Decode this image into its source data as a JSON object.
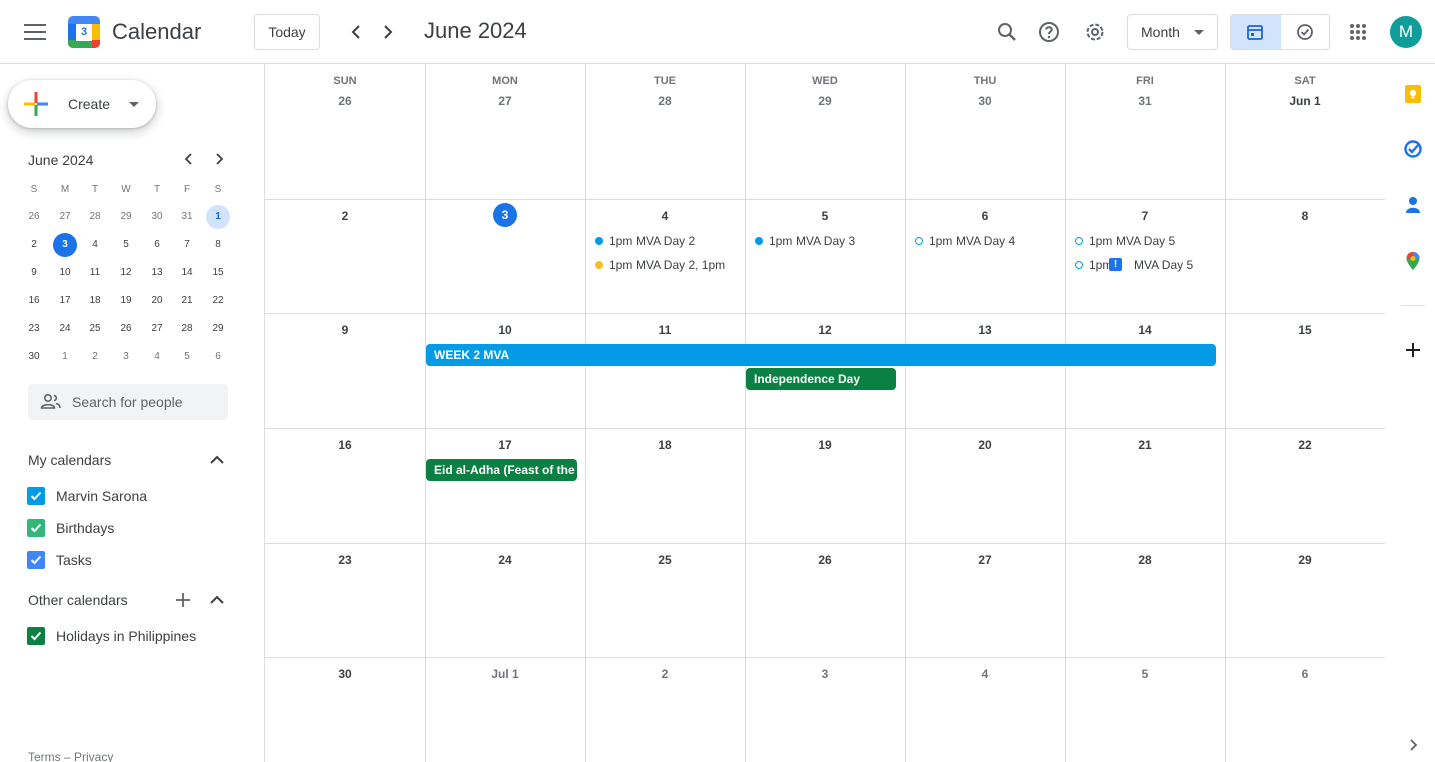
{
  "app": {
    "title": "Calendar",
    "logo_day": "3"
  },
  "header": {
    "today_label": "Today",
    "period": "June 2024",
    "view": "Month",
    "avatar_initial": "M",
    "icons": [
      "menu-icon",
      "chevron-left-icon",
      "chevron-right-icon",
      "search-icon",
      "help-icon",
      "settings-icon",
      "calendar-view-icon",
      "tasks-view-icon",
      "apps-icon"
    ]
  },
  "sidebar": {
    "create_label": "Create",
    "mini_month": {
      "title": "June 2024",
      "weekday_heads": [
        "S",
        "M",
        "T",
        "W",
        "T",
        "F",
        "S"
      ],
      "weeks": [
        [
          "26",
          "27",
          "28",
          "29",
          "30",
          "31",
          "1"
        ],
        [
          "2",
          "3",
          "4",
          "5",
          "6",
          "7",
          "8"
        ],
        [
          "9",
          "10",
          "11",
          "12",
          "13",
          "14",
          "15"
        ],
        [
          "16",
          "17",
          "18",
          "19",
          "20",
          "21",
          "22"
        ],
        [
          "23",
          "24",
          "25",
          "26",
          "27",
          "28",
          "29"
        ],
        [
          "30",
          "1",
          "2",
          "3",
          "4",
          "5",
          "6"
        ]
      ],
      "today": "3",
      "selected": "1"
    },
    "search_people_placeholder": "Search for people",
    "my_calendars": {
      "title": "My calendars",
      "items": [
        {
          "name": "Marvin Sarona",
          "color": "#039be5"
        },
        {
          "name": "Birthdays",
          "color": "#33b679"
        },
        {
          "name": "Tasks",
          "color": "#4285f4"
        }
      ]
    },
    "other_calendars": {
      "title": "Other calendars",
      "items": [
        {
          "name": "Holidays in Philippines",
          "color": "#0b8043"
        }
      ]
    },
    "footer": "Terms – Privacy"
  },
  "month": {
    "weekdays": [
      "SUN",
      "MON",
      "TUE",
      "WED",
      "THU",
      "FRI",
      "SAT"
    ],
    "weeks": [
      [
        "26",
        "27",
        "28",
        "29",
        "30",
        "31",
        "Jun 1"
      ],
      [
        "2",
        "3",
        "4",
        "5",
        "6",
        "7",
        "8"
      ],
      [
        "9",
        "10",
        "11",
        "12",
        "13",
        "14",
        "15"
      ],
      [
        "16",
        "17",
        "18",
        "19",
        "20",
        "21",
        "22"
      ],
      [
        "23",
        "24",
        "25",
        "26",
        "27",
        "28",
        "29"
      ],
      [
        "30",
        "Jul 1",
        "2",
        "3",
        "4",
        "5",
        "6"
      ]
    ],
    "events": [
      {
        "time": "1pm",
        "title": "MVA Day 2",
        "dot": "#039be5"
      },
      {
        "time": "1pm",
        "title": "MVA Day 2, 1pm",
        "dot": "#f6bf26"
      },
      {
        "time": "1pm",
        "title": "MVA Day 3",
        "dot": "#039be5"
      },
      {
        "time": "1pm",
        "title": "MVA Day 4",
        "dot": "#039be5"
      },
      {
        "time": "1pm",
        "title": "MVA Day 5",
        "dot": "#039be5"
      },
      {
        "time": "1pm",
        "title": "MVA Day 5",
        "dot": "#039be5",
        "badge": "!"
      }
    ],
    "all_day": [
      {
        "title": "WEEK 2 MVA",
        "color": "#039be5"
      },
      {
        "title": "Independence Day",
        "color": "#0b8043"
      },
      {
        "title": "Eid al-Adha (Feast of the",
        "color": "#0b8043"
      }
    ]
  },
  "rail": {
    "icons": [
      "keep-icon",
      "tasks-icon",
      "contacts-icon",
      "maps-icon",
      "add-icon",
      "expand-panel-icon"
    ]
  }
}
